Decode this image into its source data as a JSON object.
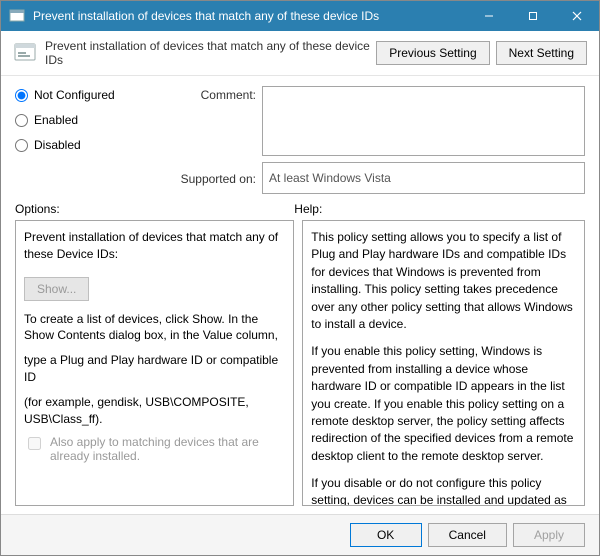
{
  "window": {
    "title": "Prevent installation of devices that match any of these device IDs"
  },
  "header": {
    "text": "Prevent installation of devices that match any of these device IDs",
    "previous_label": "Previous Setting",
    "next_label": "Next Setting"
  },
  "radios": {
    "not_configured": "Not Configured",
    "enabled": "Enabled",
    "disabled": "Disabled",
    "selected": "not_configured"
  },
  "comment": {
    "label": "Comment:",
    "value": ""
  },
  "supported": {
    "label": "Supported on:",
    "value": "At least Windows Vista"
  },
  "sections": {
    "options_label": "Options:",
    "help_label": "Help:"
  },
  "options": {
    "heading": "Prevent installation of devices that match any of these Device IDs:",
    "show_button": "Show...",
    "instr1": "To create a list of devices, click Show. In the Show Contents dialog box, in the Value column,",
    "instr2": "type a Plug and Play hardware ID or compatible ID",
    "instr3": "(for example, gendisk, USB\\COMPOSITE, USB\\Class_ff).",
    "also_apply_label": "Also apply to matching devices that are already installed."
  },
  "help": {
    "p1": "This policy setting allows you to specify a list of Plug and Play hardware IDs and compatible IDs for devices that Windows is prevented from installing. This policy setting takes precedence over any other policy setting that allows Windows to install a device.",
    "p2": "If you enable this policy setting, Windows is prevented from installing a device whose hardware ID or compatible ID appears in the list you create. If you enable this policy setting on a remote desktop server, the policy setting affects redirection of the specified devices from a remote desktop client to the remote desktop server.",
    "p3": "If you disable or do not configure this policy setting, devices can be installed and updated as allowed or prevented by other policy settings."
  },
  "footer": {
    "ok": "OK",
    "cancel": "Cancel",
    "apply": "Apply"
  }
}
